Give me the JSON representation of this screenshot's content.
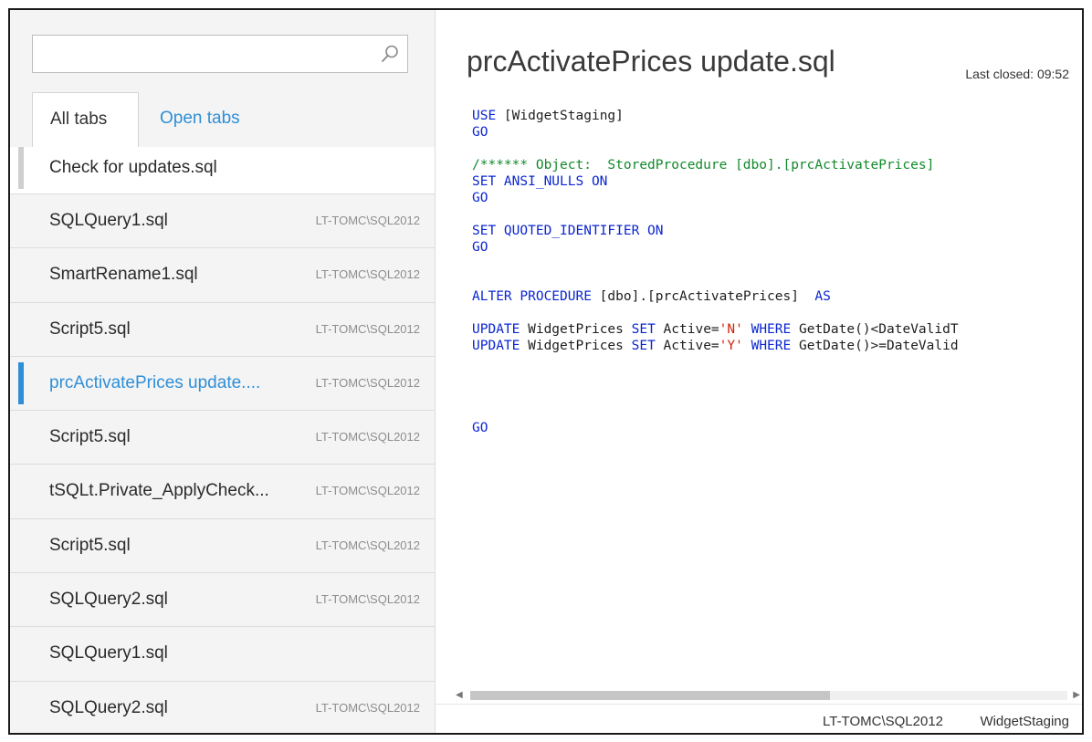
{
  "search": {
    "value": "",
    "placeholder": ""
  },
  "tabs": {
    "all": "All tabs",
    "open": "Open tabs"
  },
  "items": [
    {
      "name": "Check for updates.sql",
      "server": ""
    },
    {
      "name": "SQLQuery1.sql",
      "server": "LT-TOMC\\SQL2012"
    },
    {
      "name": "SmartRename1.sql",
      "server": "LT-TOMC\\SQL2012"
    },
    {
      "name": "Script5.sql",
      "server": "LT-TOMC\\SQL2012"
    },
    {
      "name": "prcActivatePrices update....",
      "server": "LT-TOMC\\SQL2012"
    },
    {
      "name": "Script5.sql",
      "server": "LT-TOMC\\SQL2012"
    },
    {
      "name": "tSQLt.Private_ApplyCheck...",
      "server": "LT-TOMC\\SQL2012"
    },
    {
      "name": "Script5.sql",
      "server": "LT-TOMC\\SQL2012"
    },
    {
      "name": "SQLQuery2.sql",
      "server": "LT-TOMC\\SQL2012"
    },
    {
      "name": "SQLQuery1.sql",
      "server": ""
    },
    {
      "name": "SQLQuery2.sql",
      "server": "LT-TOMC\\SQL2012"
    }
  ],
  "editor": {
    "title": "prcActivatePrices update.sql",
    "last_closed": "Last closed: 09:52",
    "code": {
      "use_kw": "USE",
      "use_db": " [WidgetStaging]",
      "go": "GO",
      "comment": "/****** Object:  StoredProcedure [dbo].[prcActivatePrices]",
      "ansi": "SET ANSI_NULLS ON",
      "quoted": "SET QUOTED_IDENTIFIER ON",
      "alter_kw": "ALTER PROCEDURE",
      "alter_obj": " [dbo].[prcActivatePrices]  ",
      "as_kw": "AS",
      "upd1_a": "UPDATE",
      "upd1_b": " WidgetPrices ",
      "upd1_c": "SET",
      "upd1_d": " Active=",
      "upd1_val": "'N'",
      "upd1_e": " ",
      "upd1_where": "WHERE",
      "upd1_f": " GetDate()<DateValidT",
      "upd2_a": "UPDATE",
      "upd2_b": " WidgetPrices ",
      "upd2_c": "SET",
      "upd2_d": " Active=",
      "upd2_val": "'Y'",
      "upd2_e": " ",
      "upd2_where": "WHERE",
      "upd2_f": " GetDate()>=DateValid"
    }
  },
  "status": {
    "server": "LT-TOMC\\SQL2012",
    "database": "WidgetStaging"
  },
  "colors": {
    "accent": "#2f8fd6",
    "keyword": "#0b26d1",
    "comment": "#118a2a",
    "string": "#d4200a"
  }
}
